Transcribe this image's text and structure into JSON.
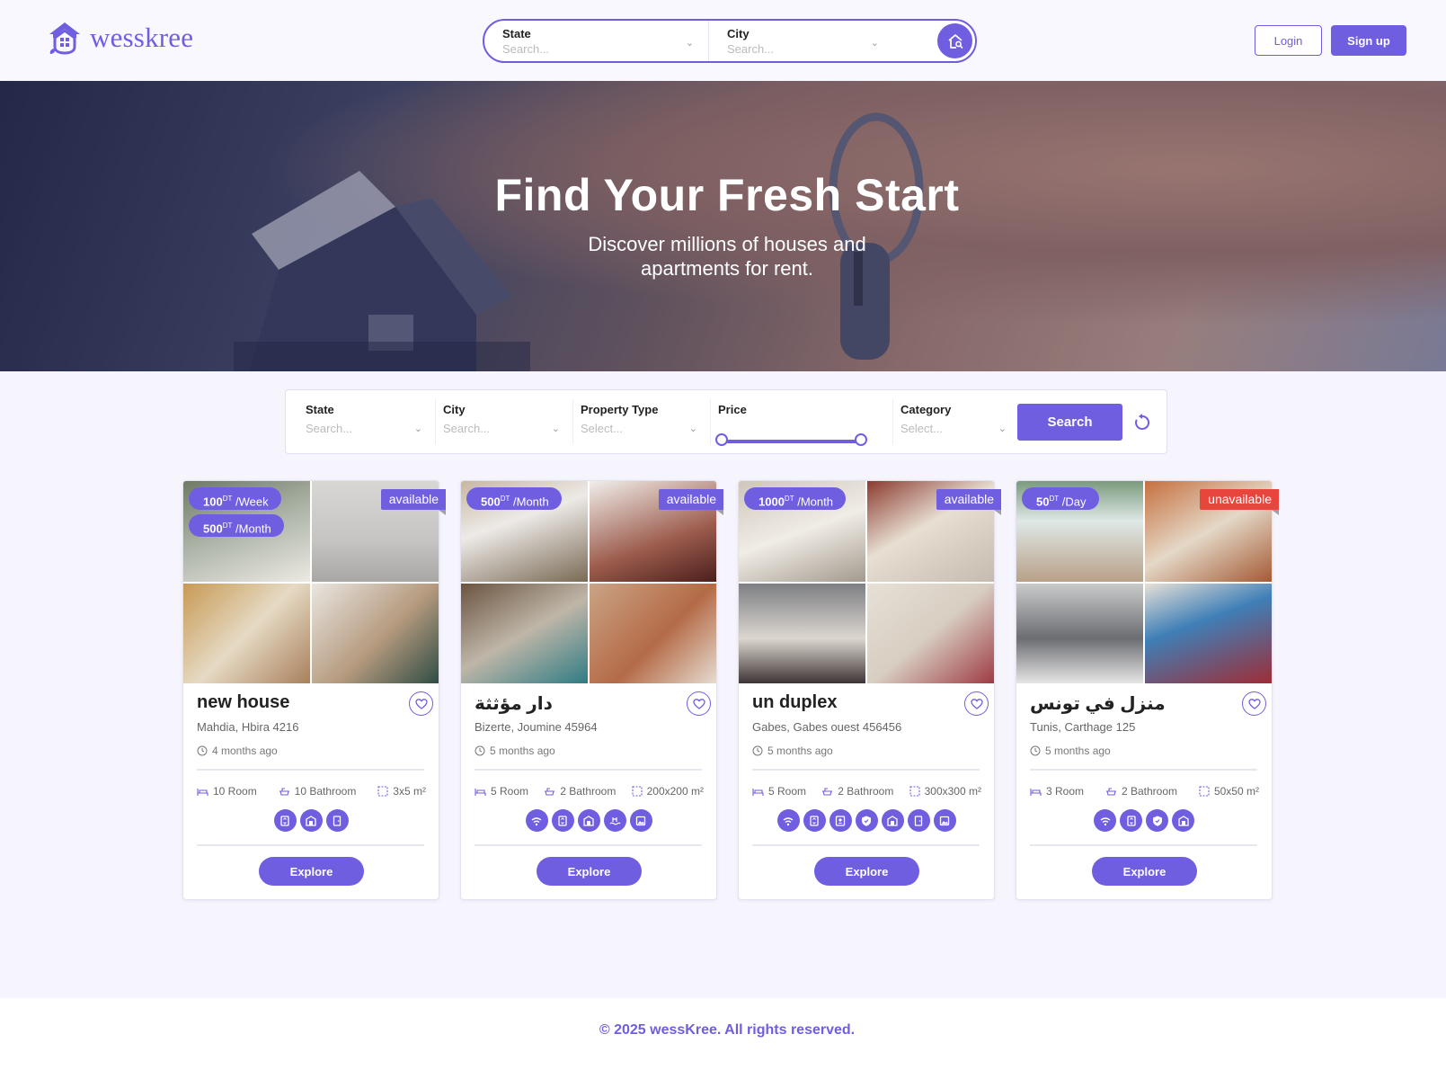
{
  "brand": {
    "name": "wesskree",
    "color": "#6f5ee0"
  },
  "topbar": {
    "state_label": "State",
    "state_placeholder": "Search...",
    "city_label": "City",
    "city_placeholder": "Search...",
    "login": "Login",
    "signup": "Sign up"
  },
  "hero": {
    "title": "Find Your Fresh Start",
    "subtitle_line1": "Discover millions of houses and",
    "subtitle_line2": "apartments for rent."
  },
  "filter": {
    "state_label": "State",
    "state_placeholder": "Search...",
    "city_label": "City",
    "city_placeholder": "Search...",
    "type_label": "Property Type",
    "type_placeholder": "Select...",
    "price_label": "Price",
    "price_range_fraction": [
      0,
      1
    ],
    "category_label": "Category",
    "category_placeholder": "Select...",
    "search": "Search"
  },
  "listings": [
    {
      "title": "new house",
      "location": "Mahdia, Hbira 4216",
      "time": "4 months ago",
      "status": "available",
      "prices": [
        {
          "amount": "100",
          "currency": "DT",
          "period": "/Week"
        },
        {
          "amount": "500",
          "currency": "DT",
          "period": "/Month"
        }
      ],
      "rooms": "10 Room",
      "bathrooms": "10 Bathroom",
      "area": "3x5 m²",
      "amenities": [
        "elevator-icon",
        "building-icon",
        "door-icon"
      ],
      "explore": "Explore"
    },
    {
      "title": "دار مؤثثة",
      "location": "Bizerte, Joumine 45964",
      "time": "5 months ago",
      "status": "available",
      "prices": [
        {
          "amount": "500",
          "currency": "DT",
          "period": "/Month"
        }
      ],
      "rooms": "5 Room",
      "bathrooms": "2 Bathroom",
      "area": "200x200 m²",
      "amenities": [
        "wifi-icon",
        "elevator-icon",
        "building-icon",
        "pool-icon",
        "picture-icon"
      ],
      "explore": "Explore"
    },
    {
      "title": "un duplex",
      "location": "Gabes, Gabes ouest 456456",
      "time": "5 months ago",
      "status": "available",
      "prices": [
        {
          "amount": "1000",
          "currency": "DT",
          "period": "/Month"
        }
      ],
      "rooms": "5 Room",
      "bathrooms": "2 Bathroom",
      "area": "300x300 m²",
      "amenities": [
        "wifi-icon",
        "elevator-icon",
        "intercom-icon",
        "shield-icon",
        "building-icon",
        "door-icon",
        "picture-icon"
      ],
      "explore": "Explore"
    },
    {
      "title": "منزل في تونس",
      "location": "Tunis, Carthage 125",
      "time": "5 months ago",
      "status": "unavailable",
      "prices": [
        {
          "amount": "50",
          "currency": "DT",
          "period": "/Day"
        }
      ],
      "rooms": "3 Room",
      "bathrooms": "2 Bathroom",
      "area": "50x50 m²",
      "amenities": [
        "wifi-icon",
        "elevator-icon",
        "shield-icon",
        "building-icon"
      ],
      "explore": "Explore"
    }
  ],
  "footer": {
    "text": "© 2025 wessKree. All rights reserved."
  }
}
